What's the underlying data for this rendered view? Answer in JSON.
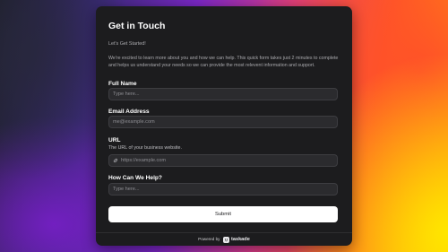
{
  "form": {
    "title": "Get in Touch",
    "subtitle": "Let's Get Started!",
    "description": "We're excited to learn more about you and how we can help. This quick form takes just 2 minutes to complete and helps us understand your needs so we can provide the most relevent information and support.",
    "fields": [
      {
        "label": "Full Name",
        "placeholder": "Type here..."
      },
      {
        "label": "Email Address",
        "placeholder": "me@example.com"
      },
      {
        "label": "URL",
        "help": "The URL of your business website.",
        "placeholder": "https://example.com",
        "icon": "link-icon"
      },
      {
        "label": "How Can We Help?",
        "placeholder": "Type here..."
      }
    ],
    "submit_label": "Submit"
  },
  "footer": {
    "powered_by": "Powered by",
    "brand": "taskade",
    "logo_icon": "taskade-logo-icon"
  },
  "colors": {
    "card": "#1c1c1e",
    "input_bg": "#2b2b2e",
    "submit_bg": "#ffffff"
  }
}
